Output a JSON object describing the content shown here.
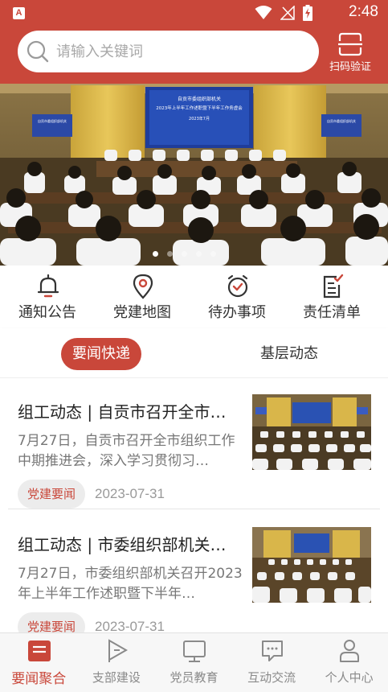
{
  "status_bar": {
    "time": "2:48",
    "app_badge": "A"
  },
  "search": {
    "placeholder": "请输入关键词",
    "scan_label": "扫码验证"
  },
  "banner": {
    "screen_title": "自贡市委组织部机关",
    "screen_subtitle": "2023年上半年工作述职暨下半年工作务虚会",
    "screen_date": "2023年7月",
    "side_screen_left": "自贡市委组织部机关",
    "side_screen_right": "自贡市委组织部机关",
    "slide_count": 5,
    "active_slide": 1
  },
  "quick_nav": [
    {
      "label": "通知公告",
      "icon": "bell-icon"
    },
    {
      "label": "党建地图",
      "icon": "map-pin-icon"
    },
    {
      "label": "待办事项",
      "icon": "alarm-clock-icon"
    },
    {
      "label": "责任清单",
      "icon": "checklist-icon"
    }
  ],
  "tabs": {
    "active": "要闻快递",
    "other": "基层动态"
  },
  "news": [
    {
      "title": "组工动态 | 自贡市召开全市…",
      "summary": "7月27日，自贡市召开全市组织工作中期推进会，深入学习贯彻习…",
      "tag": "党建要闻",
      "date": "2023-07-31"
    },
    {
      "title": "组工动态 | 市委组织部机关…",
      "summary": "7月27日，市委组织部机关召开2023年上半年工作述职暨下半年…",
      "tag": "党建要闻",
      "date": "2023-07-31"
    }
  ],
  "bottom_nav": [
    {
      "label": "要闻聚合",
      "icon": "news-icon",
      "active": true
    },
    {
      "label": "支部建设",
      "icon": "flag-icon",
      "active": false
    },
    {
      "label": "党员教育",
      "icon": "monitor-icon",
      "active": false
    },
    {
      "label": "互动交流",
      "icon": "chat-icon",
      "active": false
    },
    {
      "label": "个人中心",
      "icon": "person-icon",
      "active": false
    }
  ],
  "colors": {
    "brand": "#c9473a",
    "inactive": "#8a8a8a"
  }
}
